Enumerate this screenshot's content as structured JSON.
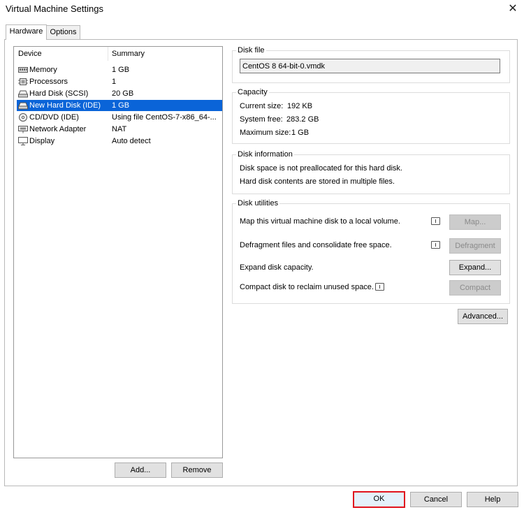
{
  "window": {
    "title": "Virtual Machine Settings"
  },
  "tabs": [
    {
      "label": "Hardware"
    },
    {
      "label": "Options"
    }
  ],
  "device_list": {
    "headers": {
      "device": "Device",
      "summary": "Summary"
    },
    "rows": [
      {
        "icon": "memory-icon",
        "device": "Memory",
        "summary": "1 GB"
      },
      {
        "icon": "processor-icon",
        "device": "Processors",
        "summary": "1"
      },
      {
        "icon": "hard-disk-icon",
        "device": "Hard Disk (SCSI)",
        "summary": "20 GB"
      },
      {
        "icon": "hard-disk-icon",
        "device": "New Hard Disk (IDE)",
        "summary": "1 GB",
        "selected": true
      },
      {
        "icon": "cd-dvd-icon",
        "device": "CD/DVD (IDE)",
        "summary": "Using file CentOS-7-x86_64-..."
      },
      {
        "icon": "network-adapter-icon",
        "device": "Network Adapter",
        "summary": "NAT"
      },
      {
        "icon": "display-icon",
        "device": "Display",
        "summary": "Auto detect"
      }
    ],
    "add_label": "Add...",
    "remove_label": "Remove"
  },
  "disk_file": {
    "title": "Disk file",
    "value": "CentOS 8 64-bit-0.vmdk"
  },
  "capacity": {
    "title": "Capacity",
    "current_label": "Current size:",
    "current_value": "192 KB",
    "free_label": "System free:",
    "free_value": "283.2 GB",
    "max_label": "Maximum size:",
    "max_value": "1 GB"
  },
  "disk_info": {
    "title": "Disk information",
    "line1": "Disk space is not preallocated for this hard disk.",
    "line2": "Hard disk contents are stored in multiple files."
  },
  "utilities": {
    "title": "Disk utilities",
    "map_text": "Map this virtual machine disk to a local volume.",
    "map_button": "Map...",
    "defrag_text": "Defragment files and consolidate free space.",
    "defrag_button": "Defragment",
    "expand_text": "Expand disk capacity.",
    "expand_button": "Expand...",
    "compact_text": "Compact disk to reclaim unused space.",
    "compact_button": "Compact"
  },
  "advanced_label": "Advanced...",
  "footer": {
    "ok": "OK",
    "cancel": "Cancel",
    "help": "Help"
  },
  "colors": {
    "selection": "#0a64d8",
    "highlight_border": "#e0141e"
  }
}
